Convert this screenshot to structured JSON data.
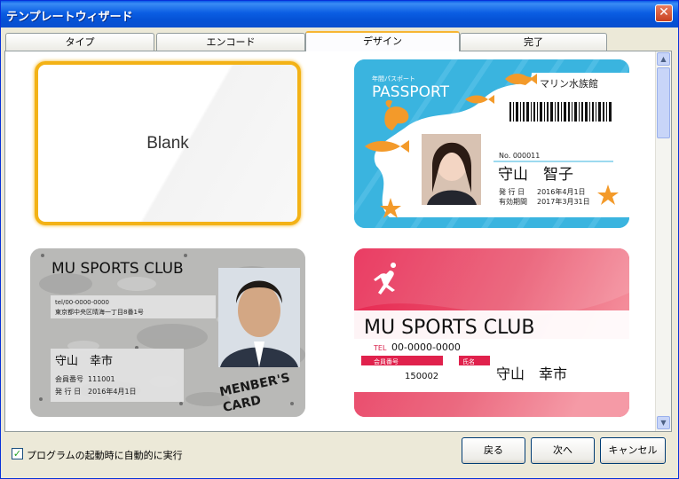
{
  "window": {
    "title": "テンプレートウィザード",
    "close_glyph": "✕"
  },
  "tabs": [
    {
      "label": "タイプ"
    },
    {
      "label": "エンコード"
    },
    {
      "label": "デザイン"
    },
    {
      "label": "完了"
    }
  ],
  "templates": {
    "blank": {
      "label": "Blank"
    },
    "passport": {
      "subtitle": "年間パスポート",
      "title": "PASSPORT",
      "venue": "マリン水族館",
      "number": "No. 000011",
      "name": "守山　智子",
      "issue_label": "発 行 日",
      "issue_date": "2016年4月1日",
      "expiry_label": "有効期間",
      "expiry_date": "2017年3月31日"
    },
    "sports_card_1": {
      "club": "MU SPORTS CLUB",
      "tel": "tel/00-0000-0000",
      "address": "東京都中央区晴海一丁目8番1号",
      "name": "守山　幸市",
      "member_no_label": "会員番号",
      "member_no": "111001",
      "issue_label": "発 行 日",
      "issue_date": "2016年4月1日",
      "stamp_line1": "MENBER'S",
      "stamp_line2": "CARD"
    },
    "sports_card_2": {
      "club": "MU SPORTS CLUB",
      "tel_label": "TEL",
      "tel": "00-0000-0000",
      "member_no_label": "会員番号",
      "name_label": "氏名",
      "member_no": "150002",
      "name": "守山　幸市"
    }
  },
  "scrollbar": {
    "up_glyph": "▲",
    "down_glyph": "▼"
  },
  "footer": {
    "autostart_checked": true,
    "check_glyph": "✓",
    "autostart_label": "プログラムの起動時に自動的に実行",
    "back_label": "戻る",
    "next_label": "次へ",
    "cancel_label": "キャンセル"
  }
}
